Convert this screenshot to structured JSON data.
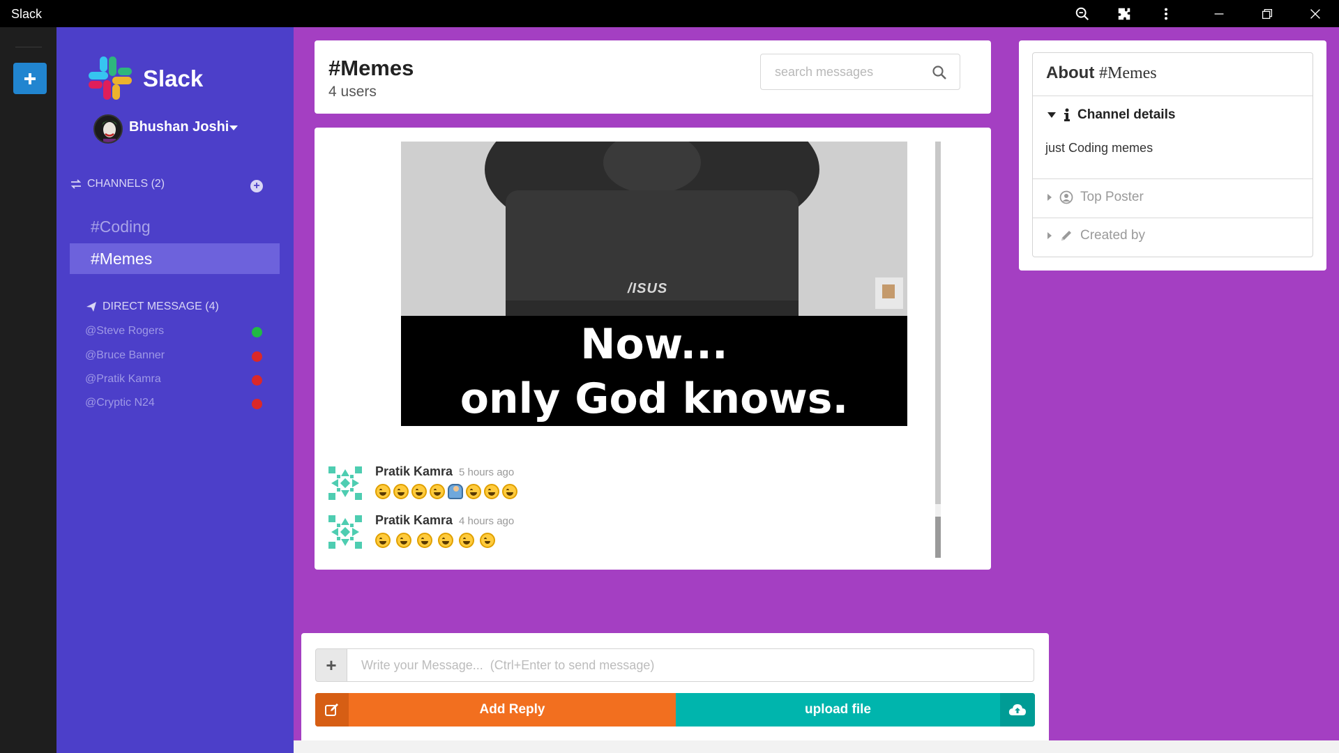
{
  "window": {
    "title": "Slack"
  },
  "sidebar": {
    "brand": "Slack",
    "user": {
      "name": "Bhushan Joshi"
    },
    "channels_header": "CHANNELS (2)",
    "channels": [
      {
        "label": "#Coding",
        "active": false
      },
      {
        "label": "#Memes",
        "active": true
      }
    ],
    "dm_header": "DIRECT MESSAGE (4)",
    "direct_messages": [
      {
        "label": "@Steve Rogers",
        "status_color": "#21ba45"
      },
      {
        "label": "@Bruce Banner",
        "status_color": "#db2828"
      },
      {
        "label": "@Pratik Kamra",
        "status_color": "#db2828"
      },
      {
        "label": "@Cryptic N24",
        "status_color": "#db2828"
      }
    ]
  },
  "channel_header": {
    "name": "#Memes",
    "user_count": "4 users",
    "search_placeholder": "search messages"
  },
  "meme": {
    "brand_on_laptop": "/ISUS",
    "caption_line1": "Now...",
    "caption_line2": "only God knows."
  },
  "messages": [
    {
      "author": "Pratik Kamra",
      "time": "5 hours ago",
      "emojis": [
        "rofl",
        "rofl",
        "rofl",
        "rofl",
        "person",
        "rofl",
        "rofl",
        "rofl"
      ]
    },
    {
      "author": "Pratik Kamra",
      "time": "4 hours ago",
      "emojis": [
        "rofl",
        "rofl",
        "rofl",
        "rofl",
        "rofl",
        "grin"
      ]
    }
  ],
  "compose": {
    "placeholder": "Write your Message...  (Ctrl+Enter to send message)",
    "add_reply_label": "Add Reply",
    "upload_label": "upload file"
  },
  "about": {
    "title_prefix": "About ",
    "title_channel": "#Memes",
    "sections": [
      {
        "label": "Channel details",
        "icon": "info-icon",
        "expanded": true
      },
      {
        "label": "Top Poster",
        "icon": "user-circle-icon",
        "expanded": false
      },
      {
        "label": "Created by",
        "icon": "pencil-icon",
        "expanded": false
      }
    ],
    "channel_description": "just Coding memes"
  },
  "colors": {
    "sidebar_bg": "#4c3fc9",
    "main_bg": "#a43fc2",
    "add_reply": "#f26f1f",
    "upload": "#00b5ad",
    "online": "#21ba45",
    "offline": "#db2828"
  }
}
